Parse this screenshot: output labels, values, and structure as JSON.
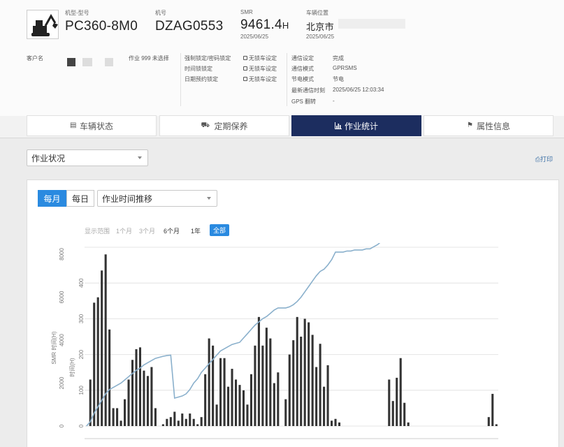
{
  "header": {
    "model_label": "机型-型号",
    "model_value": "PC360-8M0",
    "serial_label": "机号",
    "serial_value": "DZAG0553",
    "smr_label": "SMR",
    "smr_value": "9461.4",
    "smr_unit": "H",
    "smr_date": "2025/06/25",
    "location_label": "车辆位置",
    "location_value": "北京市",
    "location_date": "2025/06/25",
    "customer_label": "客户名",
    "work_select": "作业 999 未选择"
  },
  "lock_settings": [
    {
      "label": "强制锁定/密码锁定",
      "value": "无锁车设定"
    },
    {
      "label": "时间锁锁定",
      "value": "无锁车设定"
    },
    {
      "label": "日期预约锁定",
      "value": "无锁车设定"
    }
  ],
  "comm_settings": [
    {
      "label": "通信设定",
      "value": "完成"
    },
    {
      "label": "通信模式",
      "value": "GPRSMS"
    },
    {
      "label": "节电模式",
      "value": "节电"
    },
    {
      "label": "最新通信时刻",
      "value": "2025/06/25 12:03:34"
    },
    {
      "label": "GPS 翻转",
      "value": "-"
    }
  ],
  "tabs": [
    {
      "label": "车辆状态",
      "icon": "document-icon",
      "active": false
    },
    {
      "label": "定期保养",
      "icon": "truck-icon",
      "active": false
    },
    {
      "label": "作业统计",
      "icon": "bar-chart-icon",
      "active": true
    },
    {
      "label": "属性信息",
      "icon": "tag-icon",
      "active": false
    }
  ],
  "toolbar": {
    "status_select": "作业状况",
    "print_label": "打印"
  },
  "chart_controls": {
    "monthly": "每月",
    "daily": "每日",
    "chart_select": "作业时间推移",
    "range_label": "显示范围",
    "ranges": [
      "1个月",
      "3个月",
      "6个月",
      "1年",
      "全部"
    ],
    "selected_range": "全部"
  },
  "chart_data": {
    "type": "bar",
    "left_axis": {
      "label": "SMR 时间(H)",
      "ticks": [
        "0",
        "2000",
        "4000",
        "6000",
        "8000"
      ],
      "range": [
        0,
        8000
      ]
    },
    "right_axis": {
      "label": "时间(H)",
      "ticks": [
        "0",
        "100",
        "200",
        "300",
        "400"
      ],
      "range": [
        0,
        500
      ]
    },
    "series": [
      {
        "type": "bar",
        "axis": "right",
        "values": [
          0,
          130,
          345,
          360,
          435,
          480,
          270,
          50,
          50,
          15,
          75,
          130,
          185,
          215,
          220,
          155,
          140,
          165,
          50,
          0,
          5,
          20,
          25,
          40,
          15,
          35,
          20,
          35,
          20,
          5,
          25,
          145,
          245,
          225,
          60,
          190,
          190,
          110,
          160,
          130,
          115,
          100,
          60,
          145,
          225,
          305,
          225,
          275,
          245,
          120,
          150,
          0,
          75,
          200,
          240,
          305,
          250,
          300,
          290,
          255,
          165,
          230,
          110,
          170,
          15,
          20,
          10,
          0,
          0,
          0,
          0,
          0,
          0,
          0,
          0,
          0,
          0,
          0,
          0,
          130,
          70,
          135,
          190,
          65,
          10,
          0,
          0,
          0,
          0,
          0,
          0,
          0,
          0,
          0,
          0,
          0,
          0,
          0,
          0,
          0,
          0,
          0,
          0,
          0,
          0,
          25,
          90,
          5
        ]
      },
      {
        "type": "line",
        "axis": "left",
        "values": [
          0,
          200,
          600,
          900,
          1200,
          1500,
          1700,
          1800,
          1900,
          2000,
          2150,
          2300,
          2450,
          2600,
          2700,
          2850,
          2950,
          3050,
          3150,
          3200,
          3250,
          3280,
          3300,
          1300,
          1350,
          1400,
          1500,
          1700,
          2000,
          2200,
          2500,
          2700,
          2900,
          3100,
          3300,
          3500,
          3600,
          3700,
          3800,
          3850,
          3900,
          4100,
          4300,
          4500,
          4700,
          4850,
          5000,
          5100,
          5250,
          5400,
          5500,
          5500,
          5500,
          5550,
          5650,
          5800,
          6000,
          6250,
          6500,
          6750,
          7000,
          7200,
          7300,
          7500,
          7750,
          8100,
          8100,
          8100,
          8150,
          8150,
          8200,
          8200,
          8200,
          8250,
          8250,
          8350,
          8450,
          8600,
          8750,
          8800,
          8800,
          8800,
          8800,
          8800,
          8800,
          8800,
          8800,
          8800,
          8800,
          8800,
          8800,
          8800,
          8800,
          8800,
          8800,
          8800,
          8800,
          8800,
          8850,
          8850,
          8900,
          8900,
          9000,
          9100,
          9300,
          9400,
          9461
        ]
      }
    ]
  }
}
